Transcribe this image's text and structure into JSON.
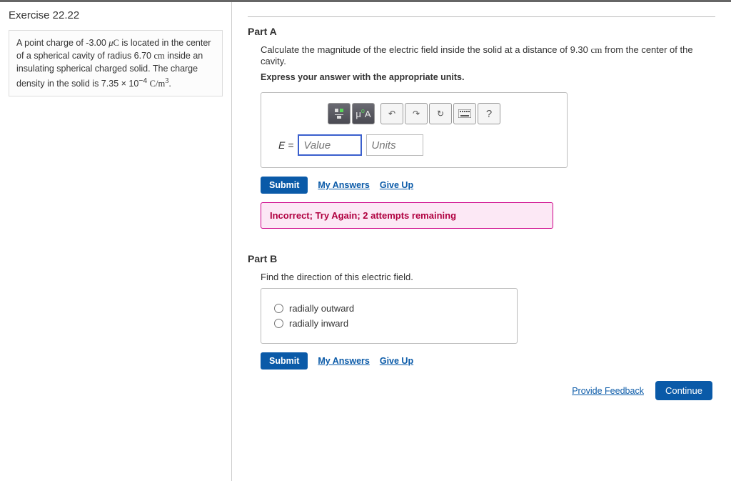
{
  "exercise": {
    "title": "Exercise 22.22",
    "problem_html": "A point charge of -3.00 μC is located in the center of a spherical cavity of radius 6.70 cm inside an insulating spherical charged solid. The charge density in the solid is 7.35 × 10⁻⁴ C/m³."
  },
  "partA": {
    "title": "Part A",
    "question": "Calculate the magnitude of the electric field inside the solid at a distance of 9.30 cm from the center of the cavity.",
    "instruction": "Express your answer with the appropriate units.",
    "eq_label": "E =",
    "value_placeholder": "Value",
    "units_placeholder": "Units",
    "toolbar": {
      "template": "template-icon",
      "ua": "μÅ",
      "undo": "↶",
      "redo": "↷",
      "reset": "↻",
      "keyboard": "⌨",
      "help": "?"
    },
    "submit": "Submit",
    "my_answers": "My Answers",
    "give_up": "Give Up",
    "feedback": "Incorrect; Try Again; 2 attempts remaining"
  },
  "partB": {
    "title": "Part B",
    "question": "Find the direction of this electric field.",
    "choices": [
      "radially outward",
      "radially inward"
    ],
    "submit": "Submit",
    "my_answers": "My Answers",
    "give_up": "Give Up"
  },
  "footer": {
    "feedback_link": "Provide Feedback",
    "continue": "Continue"
  }
}
